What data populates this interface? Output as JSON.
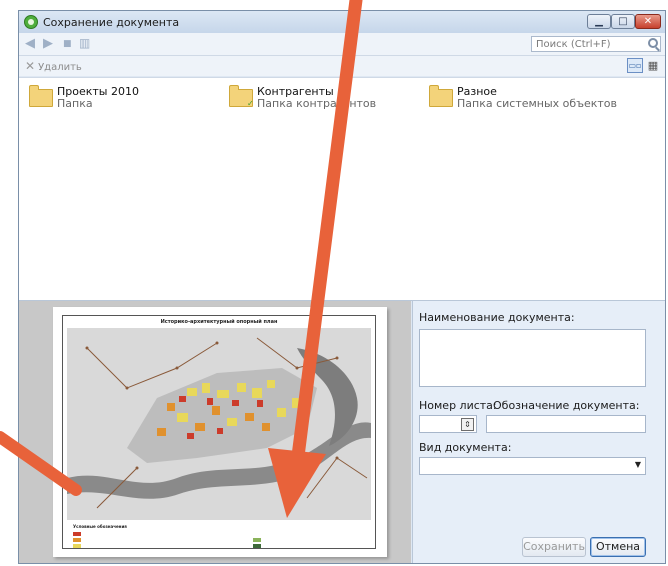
{
  "window": {
    "title": "Сохранение документа",
    "accent_color": "#4fae3d"
  },
  "navbar": {
    "search_placeholder": "Поиск (Ctrl+F)"
  },
  "actions": {
    "delete_label": "Удалить"
  },
  "folders": [
    {
      "name": "Проекты 2010",
      "description": "Папка",
      "icon": "folder-icon"
    },
    {
      "name": "Контрагенты",
      "description": "Папка контрагентов",
      "icon": "folder-contacts-icon"
    },
    {
      "name": "Разное",
      "description": "Папка системных объектов",
      "icon": "folder-icon"
    }
  ],
  "preview": {
    "map_title": "Историко-архитектурный опорный план",
    "legend_title": "Условные обозначения"
  },
  "form": {
    "doc_name_label": "Наименование документа:",
    "sheet_number_label": "Номер листа:",
    "doc_code_label": "Обозначение документа:",
    "doc_type_label": "Вид документа:",
    "save_label": "Сохранить",
    "cancel_label": "Отмена"
  },
  "annotation": {
    "arrow_color": "#e8623a"
  }
}
